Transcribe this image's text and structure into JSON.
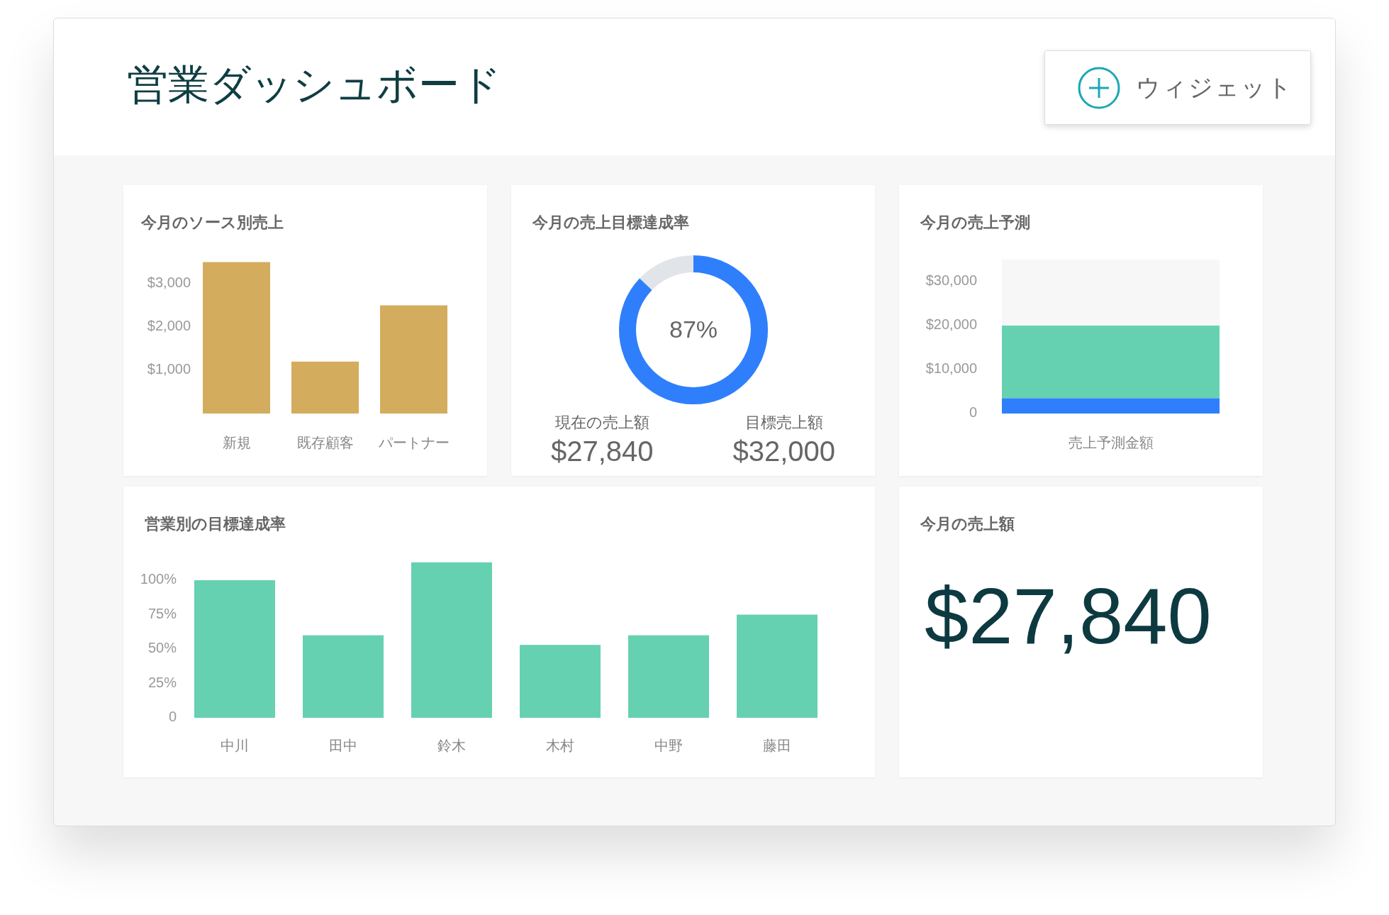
{
  "header": {
    "title": "営業ダッシュボード",
    "add_button": {
      "label": "ウィジェット"
    }
  },
  "cards": [
    {
      "kind": "bar",
      "title": "今月のソース別売上",
      "chart_data": {
        "type": "bar",
        "categories": [
          "新規",
          "既存顧客",
          "パートナー"
        ],
        "series": [
          {
            "color": "#d4ac5e",
            "values": [
              3500,
              1200,
              2500
            ]
          }
        ],
        "ylim": [
          0,
          3500
        ],
        "yticks": [
          {
            "value": 1000,
            "label": "$1,000"
          },
          {
            "value": 2000,
            "label": "$2,000"
          },
          {
            "value": 3000,
            "label": "$3,000"
          }
        ]
      }
    },
    {
      "kind": "gauge",
      "title": "今月の売上目標達成率",
      "level": 0.87,
      "reading": "87%",
      "stats": [
        {
          "label": "現在の売上額",
          "value": "$27,840"
        },
        {
          "label": "目標売上額",
          "value": "$32,000"
        }
      ]
    },
    {
      "kind": "stacked",
      "title": "今月の売上予測",
      "chart_data": {
        "type": "bar",
        "stacked": true,
        "categories": [
          "売上予測金額"
        ],
        "series": [
          {
            "color": "#2f7ffc",
            "values": [
              3500
            ]
          },
          {
            "color": "#66d1b0",
            "values": [
              16500
            ]
          }
        ],
        "ylim": [
          0,
          35000
        ],
        "yticks": [
          {
            "value": 0,
            "label": "0"
          },
          {
            "value": 10000,
            "label": "$10,000"
          },
          {
            "value": 20000,
            "label": "$20,000"
          },
          {
            "value": 30000,
            "label": "$30,000"
          }
        ]
      }
    },
    {
      "kind": "bar",
      "title": "営業別の目標達成率",
      "chart_data": {
        "type": "bar",
        "categories": [
          "中川",
          "田中",
          "鈴木",
          "木村",
          "中野",
          "藤田"
        ],
        "series": [
          {
            "color": "#66d1b0",
            "values": [
              100,
              60,
              113,
              53,
              60,
              75
            ]
          }
        ],
        "ylim": [
          0,
          113
        ],
        "yticks": [
          {
            "value": 0,
            "label": "0"
          },
          {
            "value": 25,
            "label": "25%"
          },
          {
            "value": 50,
            "label": "50%"
          },
          {
            "value": 75,
            "label": "75%"
          },
          {
            "value": 100,
            "label": "100%"
          }
        ]
      }
    },
    {
      "kind": "stat",
      "title": "今月の売上額",
      "value": "$27,840"
    }
  ]
}
